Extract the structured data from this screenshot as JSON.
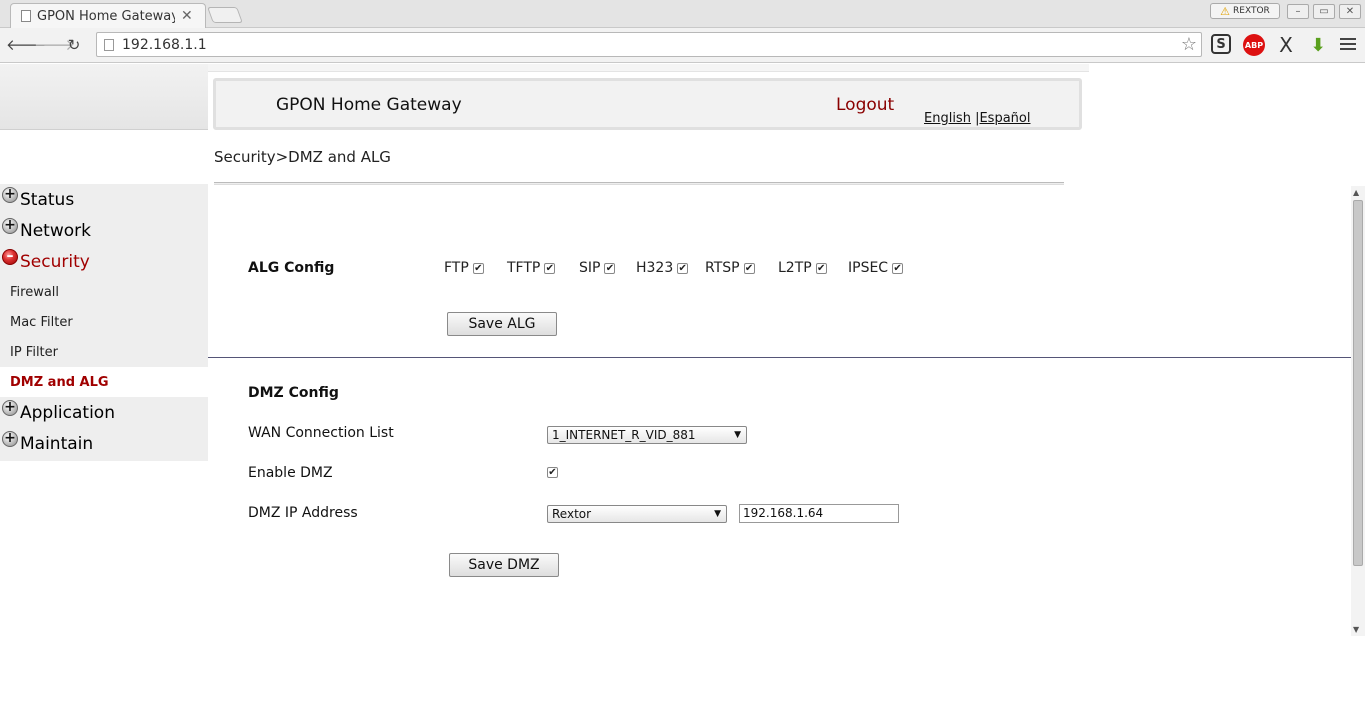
{
  "browser": {
    "tab_title": "GPON Home Gateway",
    "tab_close": "✕",
    "url": "192.168.1.1",
    "profile_name": "REXTOR",
    "extensions": {
      "s": "S",
      "abp": "ABP",
      "x": "X"
    }
  },
  "header": {
    "title": "GPON Home Gateway",
    "logout": "Logout",
    "lang_english": "English",
    "lang_separator": " |",
    "lang_spanish": "Español"
  },
  "breadcrumb": "Security>DMZ and ALG",
  "sidebar": {
    "groups": [
      {
        "label": "Status"
      },
      {
        "label": "Network"
      },
      {
        "label": "Security"
      },
      {
        "label": "Application"
      },
      {
        "label": "Maintain"
      }
    ],
    "security_items": [
      {
        "label": "Firewall"
      },
      {
        "label": "Mac Filter"
      },
      {
        "label": "IP Filter"
      },
      {
        "label": "DMZ and ALG"
      }
    ]
  },
  "alg": {
    "title": "ALG Config",
    "items": [
      {
        "label": "FTP",
        "checked": true
      },
      {
        "label": "TFTP",
        "checked": true
      },
      {
        "label": "SIP",
        "checked": true
      },
      {
        "label": "H323",
        "checked": true
      },
      {
        "label": "RTSP",
        "checked": true
      },
      {
        "label": "L2TP",
        "checked": true
      },
      {
        "label": "IPSEC",
        "checked": true
      }
    ],
    "save_label": "Save ALG"
  },
  "dmz": {
    "title": "DMZ Config",
    "wan_label": "WAN Connection List",
    "wan_value": "1_INTERNET_R_VID_881",
    "enable_label": "Enable DMZ",
    "enable_checked": true,
    "ip_label": "DMZ IP Address",
    "ip_device": "Rextor",
    "ip_value": "192.168.1.64",
    "save_label": "Save DMZ"
  }
}
